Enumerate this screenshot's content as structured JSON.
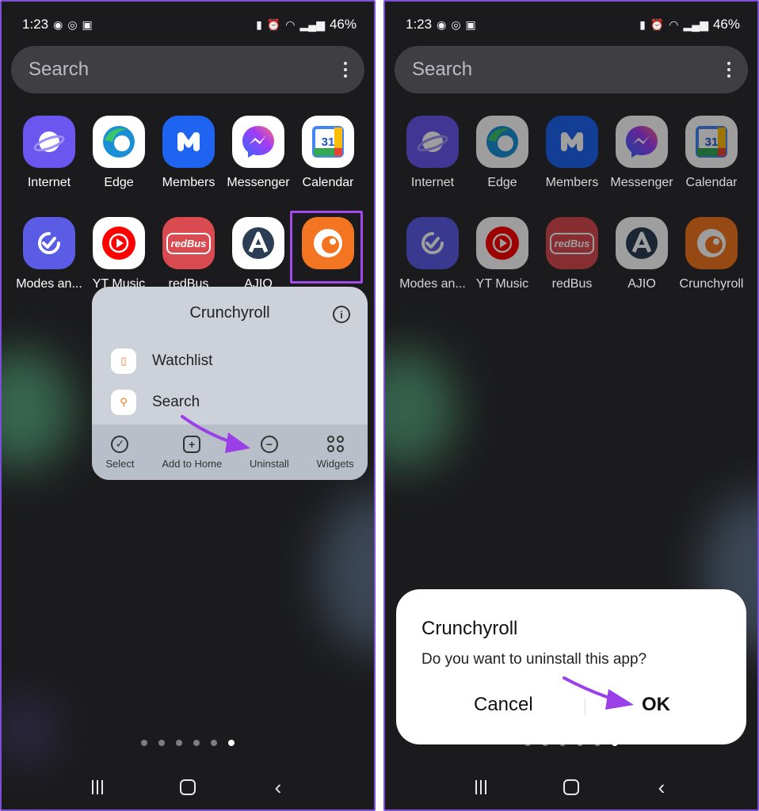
{
  "left": {
    "status": {
      "time": "1:23",
      "battery": "46%"
    },
    "search": {
      "placeholder": "Search"
    },
    "apps_row1": [
      {
        "label": "Internet"
      },
      {
        "label": "Edge"
      },
      {
        "label": "Members"
      },
      {
        "label": "Messenger"
      },
      {
        "label": "Calendar",
        "badge": "31"
      }
    ],
    "apps_row2": [
      {
        "label": "Modes an..."
      },
      {
        "label": "YT Music"
      },
      {
        "label": "redBus",
        "icon_text": "redBus"
      },
      {
        "label": "AJIO",
        "icon_text": "A"
      },
      {
        "label": ""
      }
    ],
    "popup": {
      "title": "Crunchyroll",
      "shortcuts": [
        "Watchlist",
        "Search"
      ],
      "actions": [
        "Select",
        "Add to Home",
        "Uninstall",
        "Widgets"
      ]
    }
  },
  "right": {
    "status": {
      "time": "1:23",
      "battery": "46%"
    },
    "search": {
      "placeholder": "Search"
    },
    "apps_row1": [
      {
        "label": "Internet"
      },
      {
        "label": "Edge"
      },
      {
        "label": "Members"
      },
      {
        "label": "Messenger"
      },
      {
        "label": "Calendar",
        "badge": "31"
      }
    ],
    "apps_row2": [
      {
        "label": "Modes an..."
      },
      {
        "label": "YT Music"
      },
      {
        "label": "redBus",
        "icon_text": "redBus"
      },
      {
        "label": "AJIO",
        "icon_text": "A"
      },
      {
        "label": "Crunchyroll"
      }
    ],
    "dialog": {
      "title": "Crunchyroll",
      "message": "Do you want to uninstall this app?",
      "cancel": "Cancel",
      "ok": "OK"
    }
  },
  "colors": {
    "highlight": "#a14ae8",
    "arrow": "#9b3fe8",
    "crunchyroll": "#f47521"
  },
  "icons": [
    "search-icon",
    "more-vert-icon",
    "info-icon",
    "bookmark-icon",
    "check-circle-icon",
    "add-home-icon",
    "minus-circle-icon",
    "widgets-icon",
    "nav-recents-icon",
    "nav-home-icon",
    "nav-back-icon"
  ]
}
